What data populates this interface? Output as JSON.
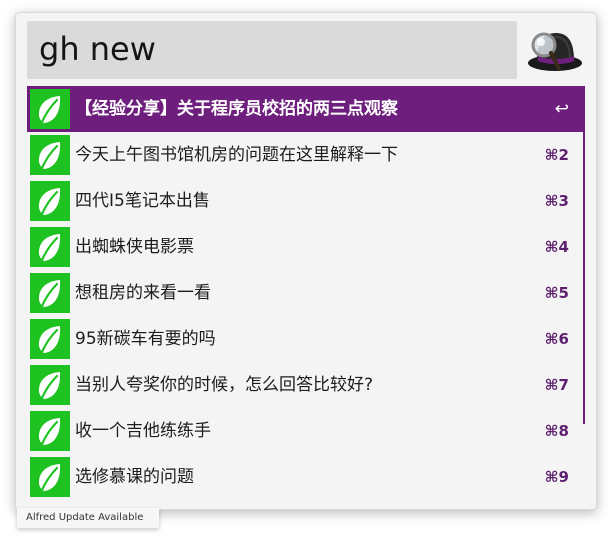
{
  "search": {
    "query": "gh new"
  },
  "app_icon": "alfred-hat-icon",
  "colors": {
    "selection": "#6e1f7d",
    "icon_background": "#1ec322",
    "shortcut_text": "#5d1f6e"
  },
  "results": [
    {
      "title": "【经验分享】关于程序员校招的两三点观察",
      "shortcut": "↩",
      "selected": true,
      "icon": "leaf-icon"
    },
    {
      "title": "今天上午图书馆机房的问题在这里解释一下",
      "shortcut": "⌘2",
      "selected": false,
      "icon": "leaf-icon"
    },
    {
      "title": "四代I5笔记本出售",
      "shortcut": "⌘3",
      "selected": false,
      "icon": "leaf-icon"
    },
    {
      "title": "出蜘蛛侠电影票",
      "shortcut": "⌘4",
      "selected": false,
      "icon": "leaf-icon"
    },
    {
      "title": "想租房的来看一看",
      "shortcut": "⌘5",
      "selected": false,
      "icon": "leaf-icon"
    },
    {
      "title": "95新碳车有要的吗",
      "shortcut": "⌘6",
      "selected": false,
      "icon": "leaf-icon"
    },
    {
      "title": "当别人夸奖你的时候，怎么回答比较好?",
      "shortcut": "⌘7",
      "selected": false,
      "icon": "leaf-icon"
    },
    {
      "title": "收一个吉他练练手",
      "shortcut": "⌘8",
      "selected": false,
      "icon": "leaf-icon"
    },
    {
      "title": "选修慕课的问题",
      "shortcut": "⌘9",
      "selected": false,
      "icon": "leaf-icon"
    }
  ],
  "update_notice": "Alfred Update Available"
}
